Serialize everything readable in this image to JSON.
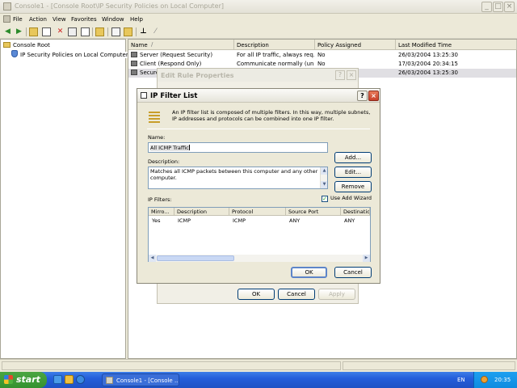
{
  "window": {
    "title": "Console1 - [Console Root\\IP Security Policies on Local Computer]"
  },
  "menu": [
    "File",
    "Action",
    "View",
    "Favorites",
    "Window",
    "Help"
  ],
  "tree": {
    "root": "Console Root",
    "child": "IP Security Policies on Local Computer"
  },
  "list": {
    "columns": [
      "Name",
      "Description",
      "Policy Assigned",
      "Last Modified Time"
    ],
    "sort_indicator": "/",
    "rows": [
      {
        "name": "Server (Request Security)",
        "description": "For all IP traffic, always req...",
        "assigned": "No",
        "modified": "26/03/2004 13:25:30"
      },
      {
        "name": "Client (Respond Only)",
        "description": "Communicate normally (uns...",
        "assigned": "No",
        "modified": "17/03/2004 20:34:15"
      },
      {
        "name": "Secure Server (Require Security)",
        "description": "",
        "assigned": "",
        "modified": "26/03/2004 13:25:30"
      }
    ]
  },
  "edit_rule_dialog": {
    "title": "Edit Rule Properties",
    "ok": "OK",
    "cancel": "Cancel",
    "apply": "Apply"
  },
  "ip_filter_dialog": {
    "title": "IP Filter List",
    "help_glyph": "?",
    "close_glyph": "×",
    "intro": "An IP filter list is composed of multiple filters. In this way, multiple subnets, IP addresses and protocols can be combined into one IP filter.",
    "name_label": "Name:",
    "name_value": "All ICMP Traffic",
    "description_label": "Description:",
    "description_value": "Matches all ICMP packets between this computer and any other computer.",
    "filters_label": "IP Filters:",
    "use_wizard_label": "Use Add Wizard",
    "use_wizard_checked": true,
    "buttons": {
      "add": "Add...",
      "edit": "Edit...",
      "remove": "Remove",
      "ok": "OK",
      "cancel": "Cancel"
    },
    "grid_columns": [
      "Mirro...",
      "Description",
      "Protocol",
      "Source Port",
      "Destination"
    ],
    "grid_rows": [
      {
        "mirrored": "Yes",
        "description": "ICMP",
        "protocol": "ICMP",
        "source_port": "ANY",
        "destination": "ANY"
      }
    ]
  },
  "taskbar": {
    "start": "start",
    "task": "Console1 - [Console ...",
    "language": "EN",
    "clock": "20:35"
  }
}
